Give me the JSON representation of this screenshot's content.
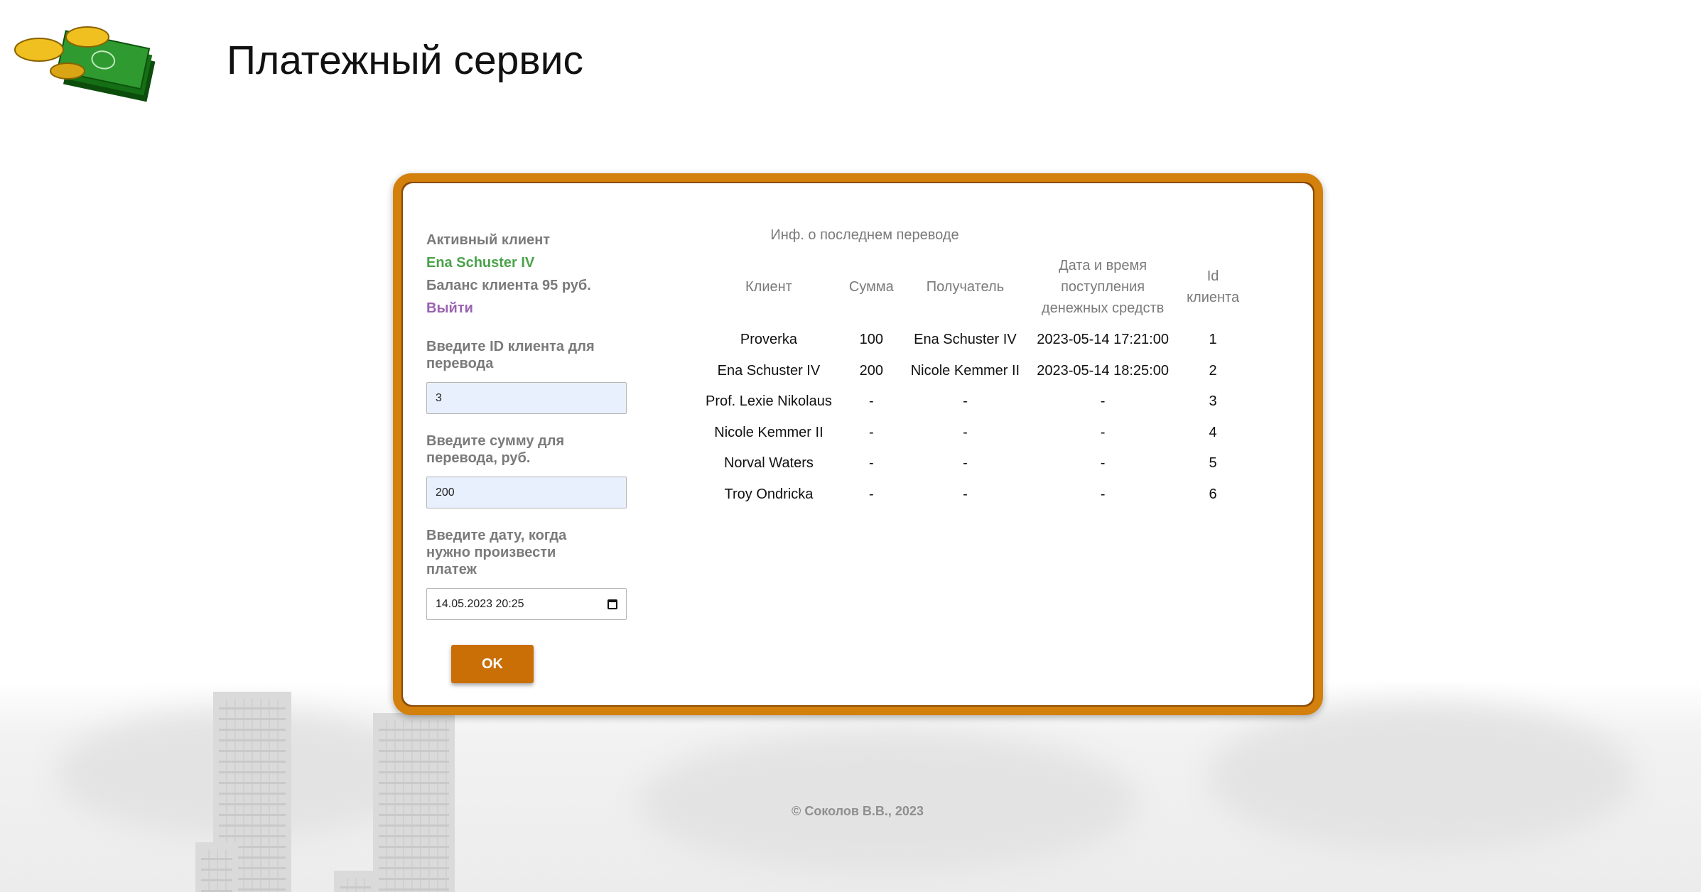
{
  "header": {
    "title": "Платежный сервис",
    "logo_icon": "money-coins-icon"
  },
  "client": {
    "active_label": "Активный клиент",
    "name": "Ena Schuster IV",
    "balance_text": "Баланс клиента 95 руб.",
    "logout_label": "Выйти"
  },
  "form": {
    "recipient_id_label": "Введите ID клиента для перевода",
    "recipient_id_value": "3",
    "amount_label": "Введите сумму для перевода, руб.",
    "amount_value": "200",
    "date_label": "Введите дату, когда нужно произвести платеж",
    "date_value": "14.05.2023 20:25",
    "ok_label": "OK"
  },
  "last_transfer": {
    "title": "Инф. о последнем переводе",
    "columns": [
      "Клиент",
      "Сумма",
      "Получатель",
      "Дата и время поступления денежных средств",
      "Id клиента"
    ],
    "rows": [
      [
        "Proverka",
        "100",
        "Ena Schuster IV",
        "2023-05-14 17:21:00",
        "1"
      ],
      [
        "Ena Schuster IV",
        "200",
        "Nicole Kemmer II",
        "2023-05-14 18:25:00",
        "2"
      ],
      [
        "Prof. Lexie Nikolaus",
        "-",
        "-",
        "-",
        "3"
      ],
      [
        "Nicole Kemmer II",
        "-",
        "-",
        "-",
        "4"
      ],
      [
        "Norval Waters",
        "-",
        "-",
        "-",
        "5"
      ],
      [
        "Troy Ondricka",
        "-",
        "-",
        "-",
        "6"
      ]
    ]
  },
  "footer": {
    "copyright": "© Соколов В.В., 2023"
  },
  "colors": {
    "card_border": "#d3800c",
    "button": "#c96f05",
    "client_name": "#4aa24a",
    "logout": "#9a62b0",
    "input_fill": "#e8f0fe"
  }
}
